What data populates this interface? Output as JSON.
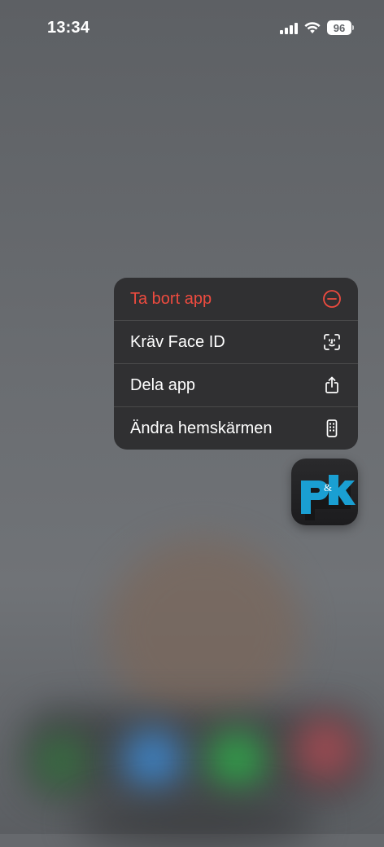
{
  "status_bar": {
    "time": "13:34",
    "battery": "96"
  },
  "context_menu": {
    "items": [
      {
        "label": "Ta bort app",
        "icon": "minus-circle-icon",
        "color": "#ee4b3f"
      },
      {
        "label": "Kräv Face ID",
        "icon": "face-id-icon",
        "color": "#ffffff"
      },
      {
        "label": "Dela app",
        "icon": "share-icon",
        "color": "#ffffff"
      },
      {
        "label": "Ändra hemskärmen",
        "icon": "phone-grid-icon",
        "color": "#ffffff"
      }
    ]
  },
  "app_icon": {
    "glyph": "pk",
    "accent": "#1a9fd2"
  }
}
